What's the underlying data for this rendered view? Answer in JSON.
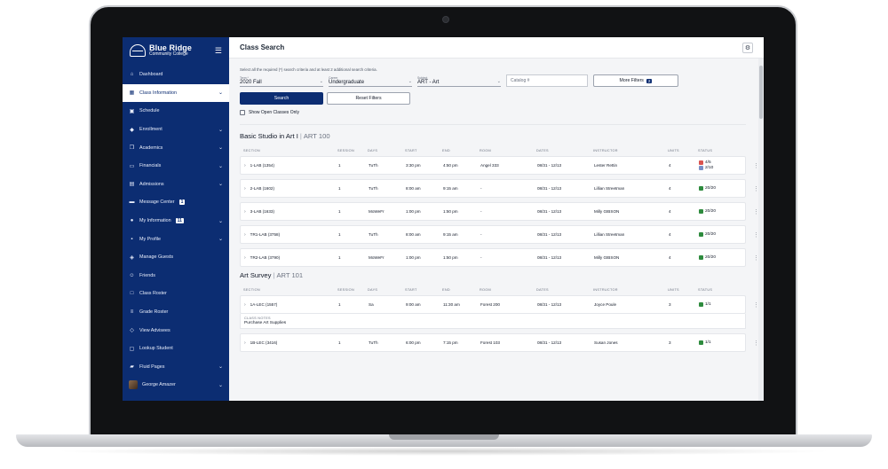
{
  "brand": {
    "name": "Blue Ridge",
    "subtitle": "Community College"
  },
  "sidebar": {
    "items": [
      {
        "label": "Dashboard",
        "icon": "home-icon",
        "chevron": false
      },
      {
        "label": "Class Information",
        "icon": "calendar-grid-icon",
        "chevron": true,
        "active": true
      },
      {
        "label": "Schedule",
        "icon": "calendar-icon",
        "chevron": false
      },
      {
        "label": "Enrollment",
        "icon": "graduation-cap-icon",
        "chevron": true
      },
      {
        "label": "Academics",
        "icon": "documents-icon",
        "chevron": true
      },
      {
        "label": "Financials",
        "icon": "credit-card-icon",
        "chevron": true
      },
      {
        "label": "Admissions",
        "icon": "id-card-icon",
        "chevron": true
      },
      {
        "label": "Message Center",
        "icon": "chat-icon",
        "chevron": false,
        "badge": "1"
      },
      {
        "label": "My Information",
        "icon": "info-icon",
        "chevron": true,
        "badge": "11"
      },
      {
        "label": "My Profile",
        "icon": "profile-icon",
        "chevron": true
      },
      {
        "label": "Manage Guests",
        "icon": "users-icon",
        "chevron": false
      },
      {
        "label": "Friends",
        "icon": "smile-icon",
        "chevron": false
      },
      {
        "label": "Class Roster",
        "icon": "roster-icon",
        "chevron": false
      },
      {
        "label": "Grade Roster",
        "icon": "grade-list-icon",
        "chevron": false
      },
      {
        "label": "View Advisees",
        "icon": "advisees-icon",
        "chevron": false
      },
      {
        "label": "Lookup Student",
        "icon": "lookup-icon",
        "chevron": false
      },
      {
        "label": "Fluid Pages",
        "icon": "folder-icon",
        "chevron": true
      },
      {
        "label": "George Amazer",
        "icon": "avatar",
        "chevron": true
      }
    ]
  },
  "header": {
    "title": "Class Search"
  },
  "search": {
    "instructions": "Select all the required (*) search criteria and at least 2 additional search criteria.",
    "term": {
      "label": "Term *",
      "value": "2020 Fall"
    },
    "career": {
      "label": "Career",
      "value": "Undergraduate"
    },
    "subject": {
      "label": "Subject",
      "value": "ART - Art"
    },
    "catalog_placeholder": "Catalog #",
    "more_filters_label": "More Filters",
    "more_filters_count": "2",
    "search_button": "Search",
    "reset_button": "Reset Filters",
    "open_only_label": "Show Open Classes Only"
  },
  "columns": [
    "SECTION",
    "SESSION",
    "DAYS",
    "START",
    "END",
    "ROOM",
    "DATES",
    "INSTRUCTOR",
    "UNITS",
    "STATUS"
  ],
  "courses": [
    {
      "title": "Basic Studio in Art I",
      "code": "ART 100",
      "rows": [
        {
          "section": "1-LAB (1354)",
          "session": "1",
          "days": "TuTh",
          "start": "3:30 pm",
          "end": "4:50 pm",
          "room": "Angel 333",
          "dates": "08/31 - 12/13",
          "instructor": "Lester Rettin",
          "units": "4",
          "status": [
            {
              "type": "closed",
              "text": "4/5"
            },
            {
              "type": "wait",
              "text": "2/10"
            }
          ]
        },
        {
          "section": "2-LAB (1602)",
          "session": "1",
          "days": "TuTh",
          "start": "8:00 am",
          "end": "9:15 am",
          "room": "-",
          "dates": "08/31 - 12/13",
          "instructor": "Lillian Streetman",
          "units": "4",
          "status": [
            {
              "type": "open",
              "text": "20/20"
            }
          ]
        },
        {
          "section": "3-LAB (1633)",
          "session": "1",
          "days": "MoWeFr",
          "start": "1:00 pm",
          "end": "1:50 pm",
          "room": "-",
          "dates": "08/31 - 12/13",
          "instructor": "Milly GIBSON",
          "units": "4",
          "status": [
            {
              "type": "open",
              "text": "20/20"
            }
          ]
        },
        {
          "section": "TR1-LAB (3758)",
          "session": "1",
          "days": "TuTh",
          "start": "8:00 am",
          "end": "9:15 am",
          "room": "-",
          "dates": "08/31 - 12/13",
          "instructor": "Lillian Streetman",
          "units": "4",
          "status": [
            {
              "type": "open",
              "text": "20/20"
            }
          ]
        },
        {
          "section": "TR2-LAB (3790)",
          "session": "1",
          "days": "MoWeFr",
          "start": "1:00 pm",
          "end": "1:50 pm",
          "room": "-",
          "dates": "08/31 - 12/13",
          "instructor": "Milly GIBSON",
          "units": "4",
          "status": [
            {
              "type": "open",
              "text": "20/20"
            }
          ]
        }
      ]
    },
    {
      "title": "Art Survey",
      "code": "ART 101",
      "rows": [
        {
          "section": "1A-LEC (1557)",
          "session": "1",
          "days": "Sa",
          "start": "9:00 am",
          "end": "11:30 am",
          "room": "Forest 200",
          "dates": "08/31 - 12/13",
          "instructor": "Joyce Poule",
          "units": "3",
          "status": [
            {
              "type": "open",
              "text": "1/1"
            }
          ],
          "notes_label": "CLASS NOTES",
          "notes_text": "Purchase Art Supplies"
        },
        {
          "section": "1B-LEC (3416)",
          "session": "1",
          "days": "TuTh",
          "start": "6:00 pm",
          "end": "7:15 pm",
          "room": "Forest 103",
          "dates": "08/31 - 12/13",
          "instructor": "Susan Jones",
          "units": "3",
          "status": [
            {
              "type": "open",
              "text": "1/1"
            }
          ]
        }
      ]
    }
  ],
  "colors": {
    "sidebar": "#0c2d72",
    "open": "#2e8b3e",
    "closed": "#d9534f",
    "waitlist": "#7a8fc7"
  }
}
